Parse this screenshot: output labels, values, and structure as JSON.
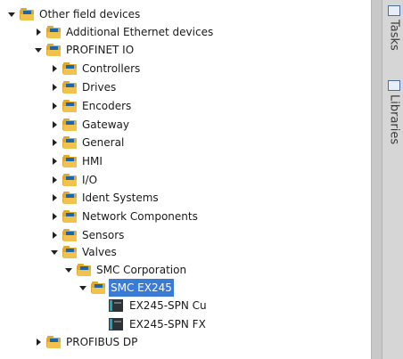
{
  "tree": {
    "items": [
      {
        "label": "Other field devices",
        "expanded": true,
        "icon": "folder-icon"
      },
      {
        "label": "Additional Ethernet devices",
        "expanded": false,
        "icon": "folder-icon"
      },
      {
        "label": "PROFINET IO",
        "expanded": true,
        "icon": "folder-icon"
      },
      {
        "label": "Controllers",
        "expanded": false,
        "icon": "folder-icon"
      },
      {
        "label": "Drives",
        "expanded": false,
        "icon": "folder-icon"
      },
      {
        "label": "Encoders",
        "expanded": false,
        "icon": "folder-icon"
      },
      {
        "label": "Gateway",
        "expanded": false,
        "icon": "folder-icon"
      },
      {
        "label": "General",
        "expanded": false,
        "icon": "folder-icon"
      },
      {
        "label": "HMI",
        "expanded": false,
        "icon": "folder-icon"
      },
      {
        "label": "I/O",
        "expanded": false,
        "icon": "folder-icon"
      },
      {
        "label": "Ident Systems",
        "expanded": false,
        "icon": "folder-icon"
      },
      {
        "label": "Network Components",
        "expanded": false,
        "icon": "folder-icon"
      },
      {
        "label": "Sensors",
        "expanded": false,
        "icon": "folder-icon"
      },
      {
        "label": "Valves",
        "expanded": true,
        "icon": "folder-icon"
      },
      {
        "label": "SMC Corporation",
        "expanded": true,
        "icon": "folder-icon"
      },
      {
        "label": "SMC EX245",
        "expanded": true,
        "selected": true,
        "icon": "folder-icon"
      },
      {
        "label": "EX245-SPN Cu",
        "icon": "device-icon"
      },
      {
        "label": "EX245-SPN FX",
        "icon": "device-icon"
      },
      {
        "label": "PROFIBUS DP",
        "expanded": false,
        "icon": "folder-icon"
      }
    ]
  },
  "sidebar": {
    "tabs": [
      {
        "label": "Tasks",
        "icon": "tasks-icon"
      },
      {
        "label": "Libraries",
        "icon": "libraries-icon"
      }
    ]
  },
  "colors": {
    "selection": "#3a7bd5",
    "folder": "#e0a92c",
    "sidebar": "#d6d6d6"
  }
}
